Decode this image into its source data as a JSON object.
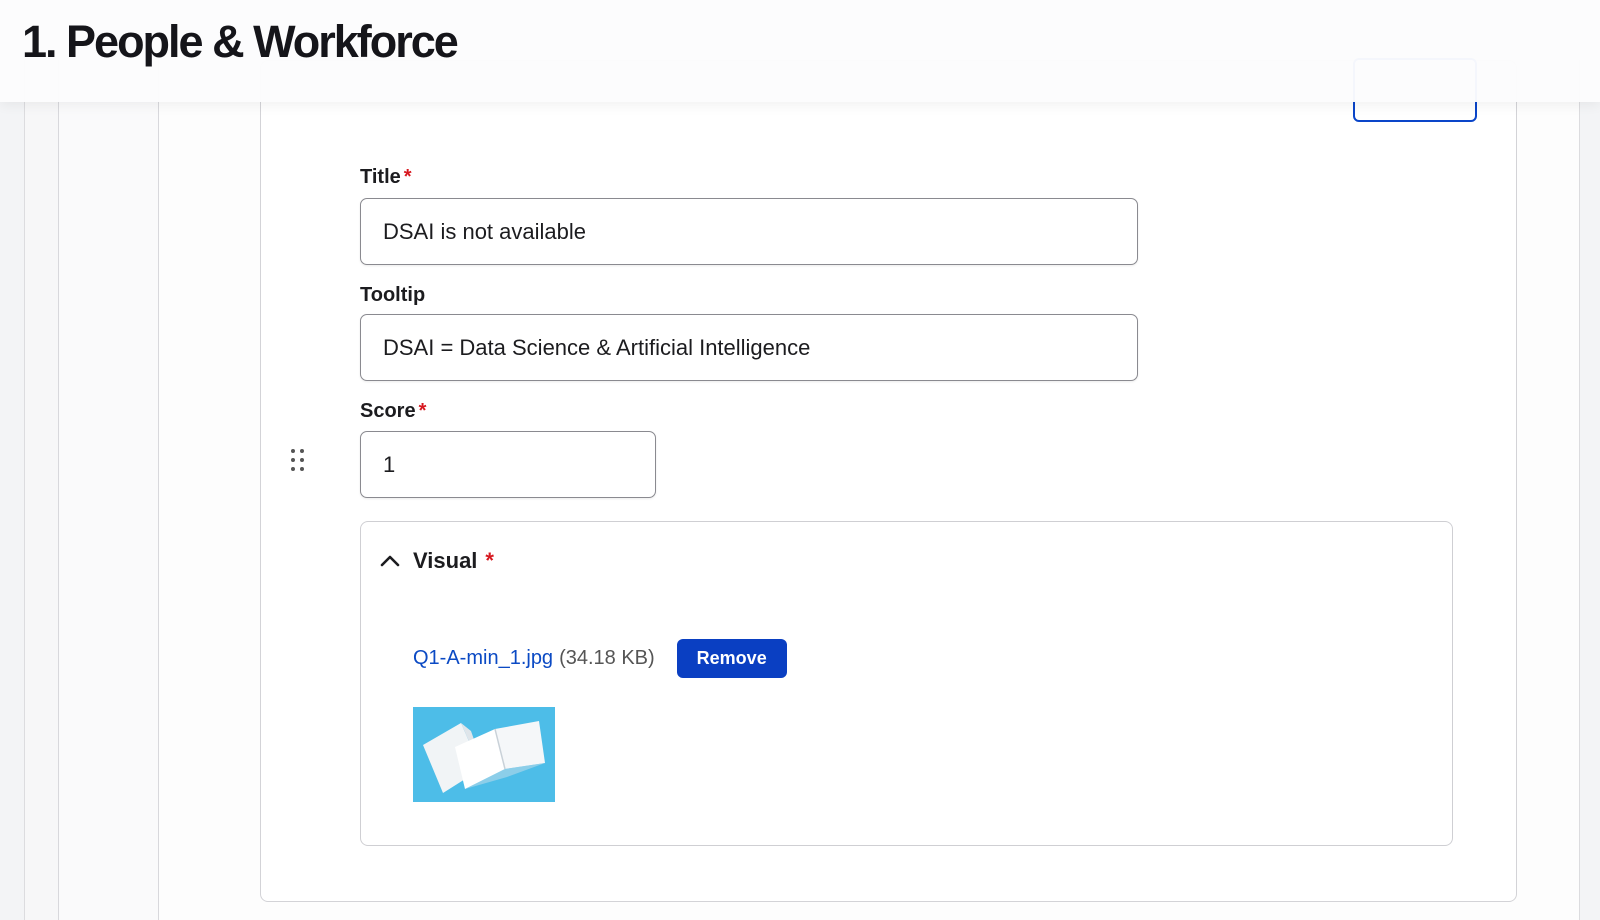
{
  "header": {
    "title": "1. People & Workforce"
  },
  "form": {
    "title": {
      "label": "Title",
      "required_mark": "*",
      "value": "DSAI is not available"
    },
    "tooltip": {
      "label": "Tooltip",
      "value": "DSAI = Data Science & Artificial Intelligence"
    },
    "score": {
      "label": "Score",
      "required_mark": "*",
      "value": "1"
    }
  },
  "visual": {
    "label": "Visual",
    "required_mark": "*",
    "expanded": true,
    "file": {
      "name": "Q1-A-min_1.jpg",
      "size": "(34.18 KB)"
    },
    "remove_label": "Remove",
    "thumbnail_icon": "open-booklet-image"
  },
  "colors": {
    "accent": "#0a3fc2",
    "link": "#0b4ac4",
    "required": "#d71920"
  }
}
